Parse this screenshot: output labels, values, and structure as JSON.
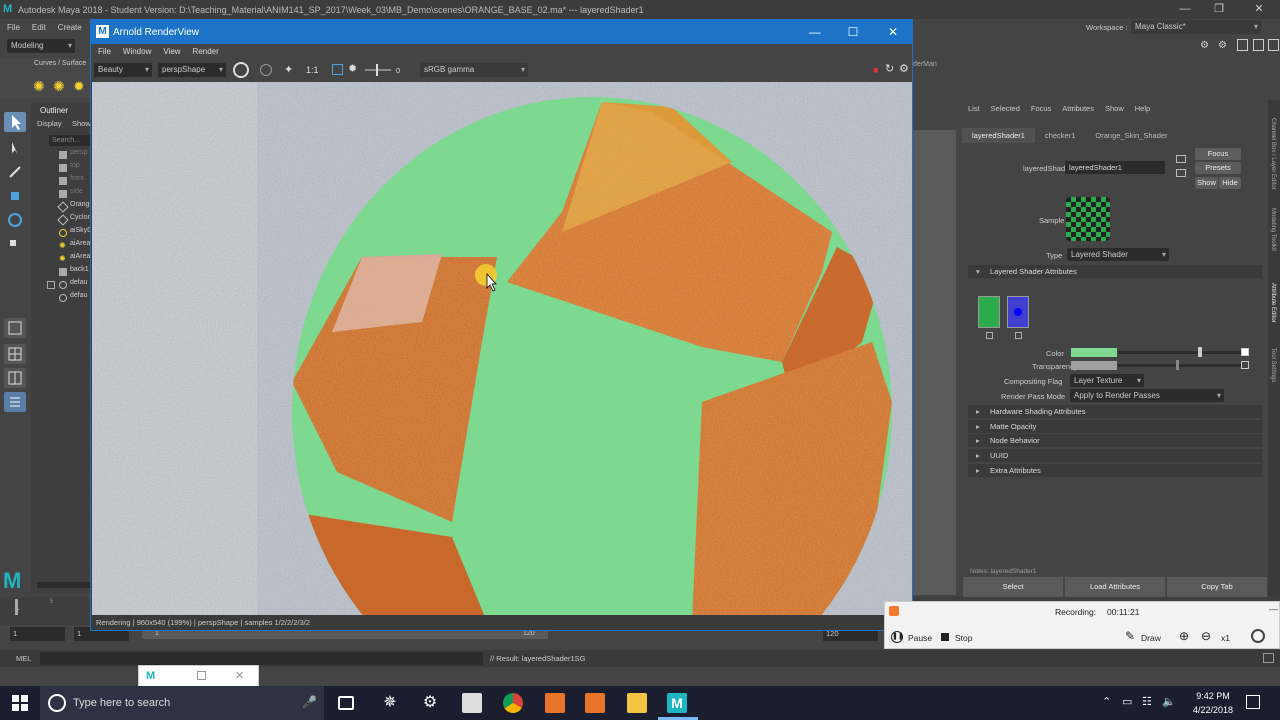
{
  "maya": {
    "title": "Autodesk Maya 2018 - Student Version: D:\\Teaching_Material\\ANIM141_SP_2017\\Week_03\\MB_Demo\\scenes\\ORANGE_BASE_02.ma*   ---   layeredShader1",
    "menu": [
      "File",
      "Edit",
      "Create"
    ],
    "module": "Modeling",
    "shelf_tab": "Curves / Surface",
    "workspace_label": "Workspace :",
    "workspace_value": "Maya Classic*",
    "viewport_menu_fragment": "derMan"
  },
  "outliner": {
    "title": "Outliner",
    "menu": [
      "Display",
      "Show"
    ],
    "search_placeholder": "Search...",
    "items": [
      "persp",
      "top",
      "front",
      "side",
      "Orange",
      "Cyclor",
      "aiSkyD",
      "aiArea",
      "aiArea",
      "back1",
      "defau",
      "defau"
    ]
  },
  "arnold": {
    "title": "Arnold RenderView",
    "menu": [
      "File",
      "Window",
      "View",
      "Render"
    ],
    "aov": "Beauty",
    "camera": "perspShape",
    "ratio": "1:1",
    "exposure": "0",
    "color_space": "sRGB gamma",
    "status": "Rendering | 960x540 (199%) | perspShape | samples 1/2/2/2/3/2"
  },
  "attr_editor": {
    "menu": [
      "List",
      "Selected",
      "Focus",
      "Attributes",
      "Show",
      "Help"
    ],
    "tabs": [
      "layeredShader1",
      "checker1",
      "Orange_Skin_Shader"
    ],
    "node_label": "layeredShader:",
    "node_value": "layeredShader1",
    "focus": "Focus",
    "presets": "Presets",
    "show": "Show",
    "hide": "Hide",
    "sample_label": "Sample",
    "type_label": "Type",
    "type_value": "Layered Shader",
    "section_open": "Layered Shader Attributes",
    "color_label": "Color",
    "transparency_label": "Transparency",
    "compositing_label": "Compositing Flag",
    "compositing_value": "Layer Texture",
    "render_pass_label": "Render Pass Mode",
    "render_pass_value": "Apply to Render Passes",
    "sections": [
      "Hardware Shading Attributes",
      "Matte Opacity",
      "Node Behavior",
      "UUID",
      "Extra Attributes"
    ],
    "notes_label": "Notes: layeredShader1",
    "bottom_buttons": [
      "Select",
      "Load Attributes",
      "Copy Tab"
    ],
    "colors": {
      "layer_green": "#2cab4a",
      "layer_blue": "#4040d0",
      "color_swatch": "#7ed88f"
    }
  },
  "right_tabs": [
    "Channel Box / Layer Editor",
    "Modeling Toolkit",
    "Attribute Editor",
    "Tool Settings"
  ],
  "timeline": {
    "start": "1",
    "tick_5": "5",
    "range_start": "1",
    "range_start_inner": "1",
    "range_mid": "1",
    "range_end_inner": "120",
    "range_end": "120"
  },
  "mel": {
    "label": "MEL",
    "result": "// Result: layeredShader1SG"
  },
  "recording": {
    "title": "Recording:",
    "time": "00:11:21",
    "pause": "Pause",
    "stop": "Stop",
    "draw": "Draw",
    "zoom": "x1"
  },
  "taskbar": {
    "search_placeholder": "Type here to search",
    "time": "9:42 PM",
    "date": "4/22/2018"
  },
  "render": {
    "sky": "#aab2bf",
    "green": "#7dd890",
    "orange": "#d8783a"
  }
}
